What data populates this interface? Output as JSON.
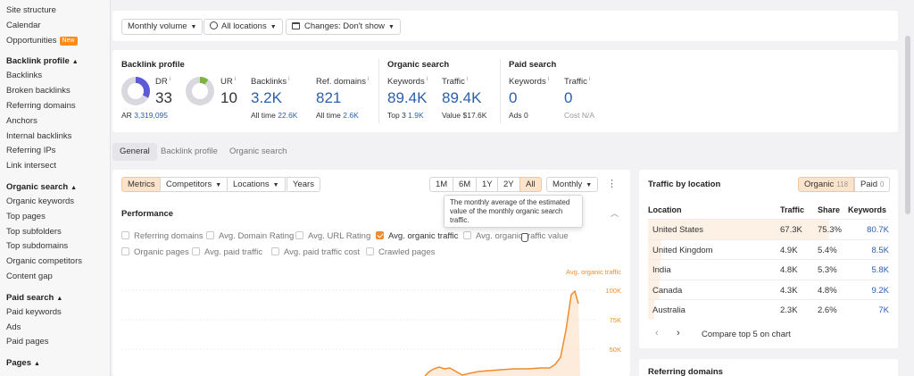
{
  "sidebar": {
    "top_items": [
      "Site structure",
      "Calendar",
      "Opportunities"
    ],
    "new_badge": "New",
    "sections": [
      {
        "title": "Backlink profile",
        "items": [
          "Backlinks",
          "Broken backlinks",
          "Referring domains",
          "Anchors",
          "Internal backlinks",
          "Referring IPs",
          "Link intersect"
        ]
      },
      {
        "title": "Organic search",
        "items": [
          "Organic keywords",
          "Top pages",
          "Top subfolders",
          "Top subdomains",
          "Organic competitors",
          "Content gap"
        ]
      },
      {
        "title": "Paid search",
        "items": [
          "Paid keywords",
          "Ads",
          "Paid pages"
        ]
      },
      {
        "title": "Pages",
        "items": []
      }
    ]
  },
  "filters": {
    "volume": "Monthly volume",
    "locations": "All locations",
    "changes": "Changes: Don't show"
  },
  "overview": {
    "backlink_profile": {
      "title": "Backlink profile",
      "dr_label": "DR",
      "dr_value": "33",
      "ar_label": "AR",
      "ar_value": "3,319,095",
      "ur_label": "UR",
      "ur_value": "10",
      "backlinks_label": "Backlinks",
      "backlinks_value": "3.2K",
      "backlinks_alltime_label": "All time",
      "backlinks_alltime": "22.6K",
      "refdomains_label": "Ref. domains",
      "refdomains_value": "821",
      "refdomains_alltime_label": "All time",
      "refdomains_alltime": "2.6K"
    },
    "organic_search": {
      "title": "Organic search",
      "keywords_label": "Keywords",
      "keywords_value": "89.4K",
      "top3_label": "Top 3",
      "top3_value": "1.9K",
      "traffic_label": "Traffic",
      "traffic_value": "89.4K",
      "value_label": "Value",
      "value_value": "$17.6K"
    },
    "paid_search": {
      "title": "Paid search",
      "keywords_label": "Keywords",
      "keywords_value": "0",
      "ads_label": "Ads",
      "ads_value": "0",
      "traffic_label": "Traffic",
      "traffic_value": "0",
      "cost_label": "Cost",
      "cost_value": "N/A"
    }
  },
  "tabs": [
    "General",
    "Backlink profile",
    "Organic search"
  ],
  "performance": {
    "toolbar": [
      "Metrics",
      "Competitors",
      "Locations",
      "Years"
    ],
    "ranges": [
      "1M",
      "6M",
      "1Y",
      "2Y",
      "All"
    ],
    "interval": "Monthly",
    "title": "Performance",
    "checkboxes_row1": [
      {
        "label": "Referring domains",
        "checked": false
      },
      {
        "label": "Avg. Domain Rating",
        "checked": false
      },
      {
        "label": "Avg. URL Rating",
        "checked": false
      },
      {
        "label": "Avg. organic traffic",
        "checked": true
      },
      {
        "label": "Avg. organic traffic value",
        "checked": false
      }
    ],
    "checkboxes_row2": [
      {
        "label": "Organic pages",
        "checked": false
      },
      {
        "label": "Avg. paid traffic",
        "checked": false
      },
      {
        "label": "Avg. paid traffic cost",
        "checked": false
      },
      {
        "label": "Crawled pages",
        "checked": false
      }
    ],
    "tooltip": "The monthly average of the estimated value of the monthly organic search traffic.",
    "series_label": "Avg. organic traffic",
    "y_ticks": [
      "100K",
      "75K",
      "50K"
    ],
    "accent": "#f08c2e"
  },
  "traffic_by_location": {
    "title": "Traffic by location",
    "organic_label": "Organic",
    "organic_count": "118",
    "paid_label": "Paid",
    "paid_count": "0",
    "columns": [
      "Location",
      "Traffic",
      "Share",
      "Keywords"
    ],
    "rows": [
      {
        "location": "United States",
        "traffic": "67.3K",
        "share": "75.3%",
        "keywords": "80.7K",
        "share_fraction": 0.753
      },
      {
        "location": "United Kingdom",
        "traffic": "4.9K",
        "share": "5.4%",
        "keywords": "8.5K",
        "share_fraction": 0.054
      },
      {
        "location": "India",
        "traffic": "4.8K",
        "share": "5.3%",
        "keywords": "5.8K",
        "share_fraction": 0.053
      },
      {
        "location": "Canada",
        "traffic": "4.3K",
        "share": "4.8%",
        "keywords": "9.2K",
        "share_fraction": 0.048
      },
      {
        "location": "Australia",
        "traffic": "2.3K",
        "share": "2.6%",
        "keywords": "7K",
        "share_fraction": 0.026
      }
    ],
    "compare_label": "Compare top 5 on chart"
  },
  "referring_domains": {
    "title": "Referring domains"
  }
}
